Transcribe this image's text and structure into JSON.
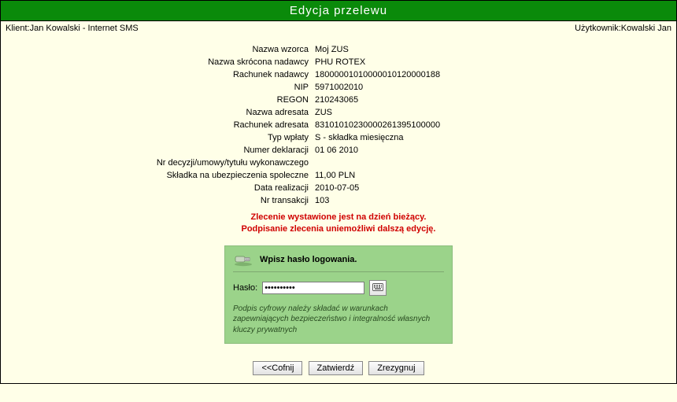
{
  "title": "Edycja przelewu",
  "client_label": "Klient:",
  "client_value": "Jan Kowalski - Internet SMS",
  "user_label": "Użytkownik:",
  "user_value": "Kowalski Jan",
  "fields": {
    "nazwa_wzorca": {
      "label": "Nazwa wzorca",
      "value": "Moj ZUS"
    },
    "nazwa_skrocona_nadawcy": {
      "label": "Nazwa skrócona nadawcy",
      "value": "PHU ROTEX"
    },
    "rachunek_nadawcy": {
      "label": "Rachunek nadawcy",
      "value": "18000001010000010120000188"
    },
    "nip": {
      "label": "NIP",
      "value": "5971002010"
    },
    "regon": {
      "label": "REGON",
      "value": "210243065"
    },
    "nazwa_adresata": {
      "label": "Nazwa adresata",
      "value": "ZUS"
    },
    "rachunek_adresata": {
      "label": "Rachunek adresata",
      "value": "83101010230000261395100000"
    },
    "typ_wplaty": {
      "label": "Typ wpłaty",
      "value": "S - składka miesięczna"
    },
    "numer_deklaracji": {
      "label": "Numer deklaracji",
      "value": "01 06 2010"
    },
    "nr_decyzji": {
      "label": "Nr decyzji/umowy/tytułu wykonawczego",
      "value": ""
    },
    "skladka": {
      "label": "Składka na ubezpieczenia spoleczne",
      "value": "11,00 PLN"
    },
    "data_realizacji": {
      "label": "Data realizacji",
      "value": "2010-07-05"
    },
    "nr_transakcji": {
      "label": "Nr transakcji",
      "value": "103"
    }
  },
  "warning_line1": "Zlecenie wystawione jest na dzień bieżący.",
  "warning_line2": "Podpisanie zlecenia uniemożliwi dalszą edycję.",
  "panel": {
    "heading": "Wpisz hasło logowania.",
    "password_label": "Hasło:",
    "password_value": "••••••••••",
    "disclaimer": "Podpis cyfrowy należy składać  w warunkach zapewniających bezpieczeństwo i integralność własnych kluczy prywatnych"
  },
  "buttons": {
    "back": "<<Cofnij",
    "confirm": "Zatwierdź",
    "resign": "Zrezygnuj"
  }
}
